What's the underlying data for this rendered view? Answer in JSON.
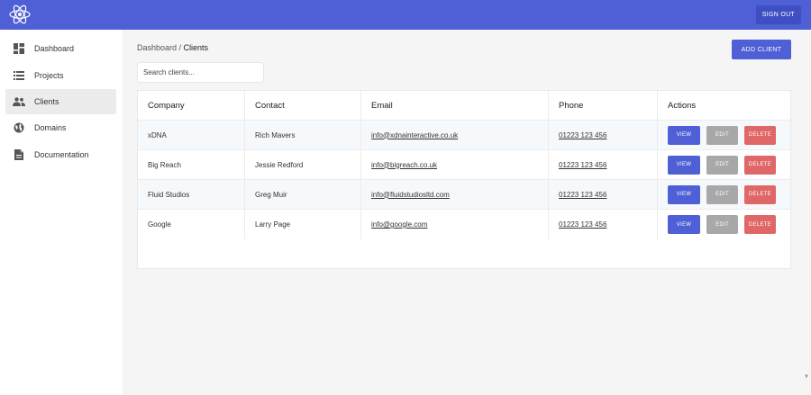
{
  "header": {
    "logo_icon": "react-atom-icon",
    "sign_out_label": "SIGN OUT",
    "bar_color": "#4f5fd6"
  },
  "sidebar": {
    "items": [
      {
        "label": "Dashboard",
        "icon": "dashboard-icon"
      },
      {
        "label": "Projects",
        "icon": "list-icon"
      },
      {
        "label": "Clients",
        "icon": "people-icon",
        "active": true
      },
      {
        "label": "Domains",
        "icon": "globe-icon"
      },
      {
        "label": "Documentation",
        "icon": "document-icon"
      }
    ]
  },
  "main": {
    "breadcrumb": {
      "parent": "Dashboard",
      "separator": " / ",
      "current": "Clients"
    },
    "add_client_label": "ADD CLIENT",
    "search_placeholder": "Search clients..."
  },
  "table": {
    "headers": [
      "Company",
      "Contact",
      "Email",
      "Phone",
      "Actions"
    ],
    "rows": [
      {
        "company": "xDNA",
        "contact": "Rich Mavers",
        "email": "info@xdnainteractive.co.uk",
        "phone": "01223 123 456"
      },
      {
        "company": "Big Reach",
        "contact": "Jessie Redford",
        "email": "info@bigreach.co.uk",
        "phone": "01223 123 456"
      },
      {
        "company": "Fluid Studios",
        "contact": "Greg Muir",
        "email": "info@fluidstudiosltd.com",
        "phone": "01223 123 456"
      },
      {
        "company": "Google",
        "contact": "Larry Page",
        "email": "info@google.com",
        "phone": "01223 123 456"
      }
    ],
    "actions": {
      "view": "VIEW",
      "edit": "EDIT",
      "delete": "DELETE"
    }
  },
  "colors": {
    "primary": "#4f5fd6",
    "edit": "#a8a8a8",
    "delete": "#e06767"
  }
}
